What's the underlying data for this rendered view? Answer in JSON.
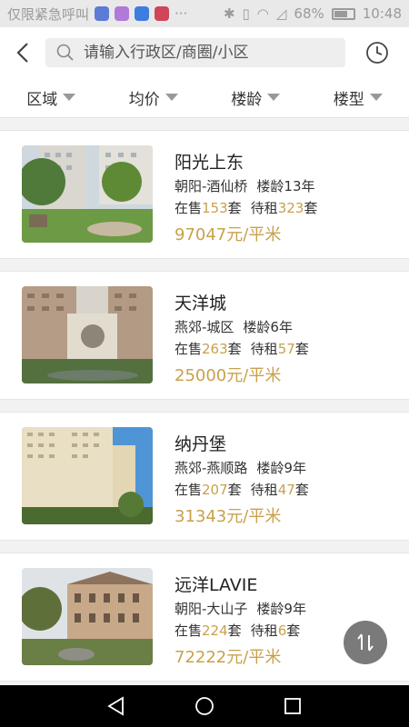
{
  "status_bar": {
    "carrier": "仅限紧急呼叫",
    "more": "···",
    "battery": "68%",
    "time": "10:48"
  },
  "search": {
    "placeholder": "请输入行政区/商圈/小区"
  },
  "filters": [
    {
      "label": "区域"
    },
    {
      "label": "均价"
    },
    {
      "label": "楼龄"
    },
    {
      "label": "楼型"
    }
  ],
  "labels": {
    "on_sale": "在售",
    "for_rent": "待租",
    "unit": "套"
  },
  "listings": [
    {
      "name": "阳光上东",
      "location": "朝阳-酒仙桥",
      "age": "楼龄13年",
      "on_sale": "153",
      "for_rent": "323",
      "price": "97047元/平米"
    },
    {
      "name": "天洋城",
      "location": "燕郊-城区",
      "age": "楼龄6年",
      "on_sale": "263",
      "for_rent": "57",
      "price": "25000元/平米"
    },
    {
      "name": "纳丹堡",
      "location": "燕郊-燕顺路",
      "age": "楼龄9年",
      "on_sale": "207",
      "for_rent": "47",
      "price": "31343元/平米"
    },
    {
      "name": "远洋LAVIE",
      "location": "朝阳-大山子",
      "age": "楼龄9年",
      "on_sale": "224",
      "for_rent": "6",
      "price": "72222元/平米"
    }
  ],
  "colors": {
    "accent": "#c8a14b"
  }
}
